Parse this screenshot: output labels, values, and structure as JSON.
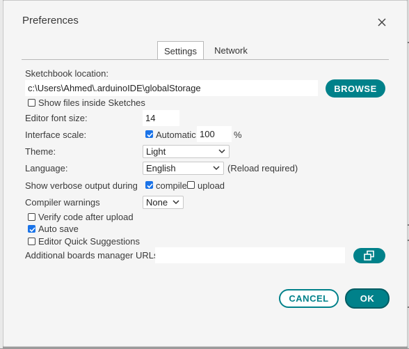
{
  "dialog": {
    "title": "Preferences"
  },
  "tabs": [
    {
      "label": "Settings",
      "active": true
    },
    {
      "label": "Network",
      "active": false
    }
  ],
  "sketchbook": {
    "label": "Sketchbook location:",
    "value": "c:\\Users\\Ahmed\\.arduinoIDE\\globalStorage",
    "browse_label": "BROWSE",
    "show_files_label": "Show files inside Sketches",
    "show_files_checked": false
  },
  "editor_font": {
    "label": "Editor font size:",
    "value": "14"
  },
  "interface_scale": {
    "label": "Interface scale:",
    "automatic_label": "Automatic",
    "automatic_checked": true,
    "value": "100",
    "unit": "%"
  },
  "theme": {
    "label": "Theme:",
    "selected": "Light"
  },
  "language": {
    "label": "Language:",
    "selected": "English",
    "note": "(Reload required)"
  },
  "verbose": {
    "label": "Show verbose output during",
    "compile_label": "compile",
    "compile_checked": true,
    "upload_label": "upload",
    "upload_checked": false
  },
  "compiler_warnings": {
    "label": "Compiler warnings",
    "selected": "None"
  },
  "options": {
    "verify_label": "Verify code after upload",
    "verify_checked": false,
    "autosave_label": "Auto save",
    "autosave_checked": true,
    "quick_suggestions_label": "Editor Quick Suggestions",
    "quick_suggestions_checked": false
  },
  "boards_manager": {
    "label": "Additional boards manager URLs:",
    "value": ""
  },
  "footer": {
    "cancel_label": "CANCEL",
    "ok_label": "OK"
  },
  "colors": {
    "accent": "#00818a",
    "checkbox": "#1a73e8"
  },
  "background_code": "COLOR: 0"
}
